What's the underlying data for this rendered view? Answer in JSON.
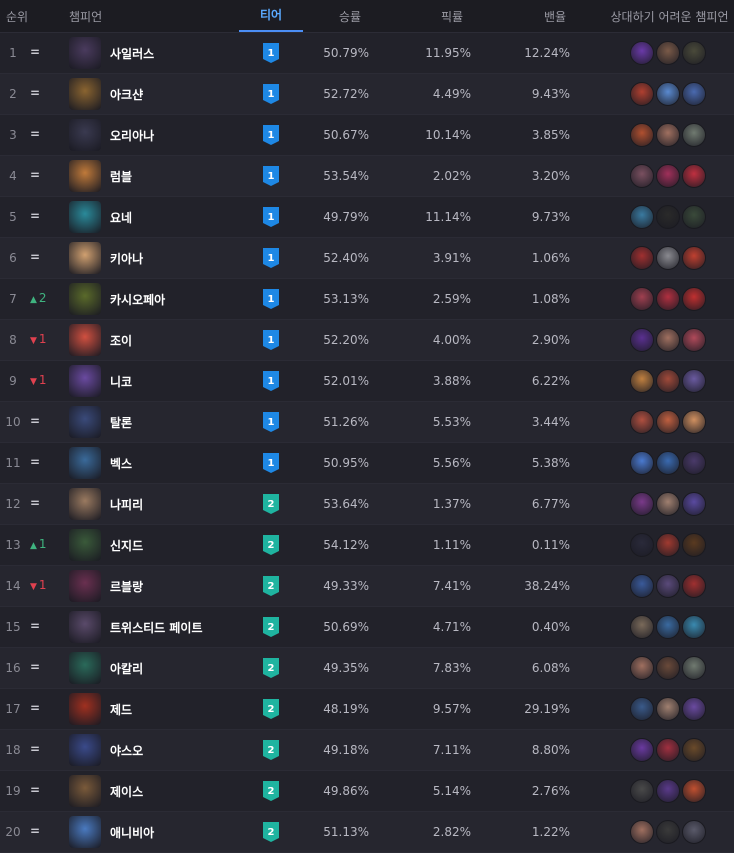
{
  "header": {
    "rank": "순위",
    "champion": "챔피언",
    "tier": "티어",
    "win_rate": "승률",
    "pick_rate": "픽률",
    "ban_rate": "밴율",
    "counters": "상대하기 어려운 챔피언"
  },
  "tier_colors": {
    "1": "#1e88e5",
    "2": "#1fb4a0"
  },
  "rows": [
    {
      "rank": "1",
      "change": "=",
      "trend": "same",
      "name": "사일러스",
      "tier": "1",
      "win": "50.79%",
      "pick": "11.95%",
      "ban": "12.24%",
      "color": "#4a3b5e",
      "counters": [
        "#6a3aa8",
        "#7a5a48",
        "#4a4a3a"
      ]
    },
    {
      "rank": "2",
      "change": "=",
      "trend": "same",
      "name": "아크샨",
      "tier": "1",
      "win": "52.72%",
      "pick": "4.49%",
      "ban": "9.43%",
      "color": "#8a6430",
      "counters": [
        "#b04030",
        "#5a8ad0",
        "#4a6ab0"
      ]
    },
    {
      "rank": "3",
      "change": "=",
      "trend": "same",
      "name": "오리아나",
      "tier": "1",
      "win": "50.67%",
      "pick": "10.14%",
      "ban": "3.85%",
      "color": "#3a3a50",
      "counters": [
        "#b05030",
        "#a07060",
        "#707a70"
      ]
    },
    {
      "rank": "4",
      "change": "=",
      "trend": "same",
      "name": "럼블",
      "tier": "1",
      "win": "53.54%",
      "pick": "2.02%",
      "ban": "3.20%",
      "color": "#c07a3a",
      "counters": [
        "#7a5060",
        "#a0305a",
        "#c03040"
      ]
    },
    {
      "rank": "5",
      "change": "=",
      "trend": "same",
      "name": "요네",
      "tier": "1",
      "win": "49.79%",
      "pick": "11.14%",
      "ban": "9.73%",
      "color": "#2a8a9a",
      "counters": [
        "#3a7aa0",
        "#2a2a2a",
        "#3a4a3a"
      ]
    },
    {
      "rank": "6",
      "change": "=",
      "trend": "same",
      "name": "키아나",
      "tier": "1",
      "win": "52.40%",
      "pick": "3.91%",
      "ban": "1.06%",
      "color": "#d0a070",
      "counters": [
        "#a03030",
        "#8a8a90",
        "#c04030"
      ]
    },
    {
      "rank": "7",
      "change": "2",
      "trend": "up",
      "name": "카시오페아",
      "tier": "1",
      "win": "53.13%",
      "pick": "2.59%",
      "ban": "1.08%",
      "color": "#5a6a2a",
      "counters": [
        "#a04050",
        "#b03040",
        "#c03030"
      ]
    },
    {
      "rank": "8",
      "change": "1",
      "trend": "down",
      "name": "조이",
      "tier": "1",
      "win": "52.20%",
      "pick": "4.00%",
      "ban": "2.90%",
      "color": "#d05040",
      "counters": [
        "#5a3090",
        "#a07060",
        "#b04a5a"
      ]
    },
    {
      "rank": "9",
      "change": "1",
      "trend": "down",
      "name": "니코",
      "tier": "1",
      "win": "52.01%",
      "pick": "3.88%",
      "ban": "6.22%",
      "color": "#6a4aa0",
      "counters": [
        "#c08040",
        "#a04a3a",
        "#6a5aa0"
      ]
    },
    {
      "rank": "10",
      "change": "=",
      "trend": "same",
      "name": "탈론",
      "tier": "1",
      "win": "51.26%",
      "pick": "5.53%",
      "ban": "3.44%",
      "color": "#3a4a7a",
      "counters": [
        "#b05040",
        "#c06040",
        "#d09060"
      ]
    },
    {
      "rank": "11",
      "change": "=",
      "trend": "same",
      "name": "벡스",
      "tier": "1",
      "win": "50.95%",
      "pick": "5.56%",
      "ban": "5.38%",
      "color": "#3a6a9a",
      "counters": [
        "#4a7ad0",
        "#3a6ab0",
        "#4a3a6a"
      ]
    },
    {
      "rank": "12",
      "change": "=",
      "trend": "same",
      "name": "나피리",
      "tier": "2",
      "win": "53.64%",
      "pick": "1.37%",
      "ban": "6.77%",
      "color": "#9a7a60",
      "counters": [
        "#7a3a8a",
        "#a08070",
        "#5a4aa0"
      ]
    },
    {
      "rank": "13",
      "change": "1",
      "trend": "up",
      "name": "신지드",
      "tier": "2",
      "win": "54.12%",
      "pick": "1.11%",
      "ban": "0.11%",
      "color": "#3a5a3a",
      "counters": [
        "#2a2a3a",
        "#a03a30",
        "#5a3a20"
      ]
    },
    {
      "rank": "14",
      "change": "1",
      "trend": "down",
      "name": "르블랑",
      "tier": "2",
      "win": "49.33%",
      "pick": "7.41%",
      "ban": "38.24%",
      "color": "#6a3050",
      "counters": [
        "#3a5a9a",
        "#5a4a7a",
        "#a03030"
      ]
    },
    {
      "rank": "15",
      "change": "=",
      "trend": "same",
      "name": "트위스티드 페이트",
      "tier": "2",
      "win": "50.69%",
      "pick": "4.71%",
      "ban": "0.40%",
      "color": "#5a4a6a",
      "counters": [
        "#7a6a5a",
        "#3a6aa0",
        "#3a8ab0"
      ]
    },
    {
      "rank": "16",
      "change": "=",
      "trend": "same",
      "name": "아칼리",
      "tier": "2",
      "win": "49.35%",
      "pick": "7.83%",
      "ban": "6.08%",
      "color": "#2a6a5a",
      "counters": [
        "#a07060",
        "#6a4a3a",
        "#707a70"
      ]
    },
    {
      "rank": "17",
      "change": "=",
      "trend": "same",
      "name": "제드",
      "tier": "2",
      "win": "48.19%",
      "pick": "9.57%",
      "ban": "29.19%",
      "color": "#a03020",
      "counters": [
        "#3a5a8a",
        "#a08070",
        "#6a4aa0"
      ]
    },
    {
      "rank": "18",
      "change": "=",
      "trend": "same",
      "name": "야스오",
      "tier": "2",
      "win": "49.18%",
      "pick": "7.11%",
      "ban": "8.80%",
      "color": "#3a4a8a",
      "counters": [
        "#6a3aa0",
        "#a03040",
        "#6a4a2a"
      ]
    },
    {
      "rank": "19",
      "change": "=",
      "trend": "same",
      "name": "제이스",
      "tier": "2",
      "win": "49.86%",
      "pick": "5.14%",
      "ban": "2.76%",
      "color": "#7a5a3a",
      "counters": [
        "#4a4a4a",
        "#5a3a8a",
        "#c05030"
      ]
    },
    {
      "rank": "20",
      "change": "=",
      "trend": "same",
      "name": "애니비아",
      "tier": "2",
      "win": "51.13%",
      "pick": "2.82%",
      "ban": "1.22%",
      "color": "#4a7ac0",
      "counters": [
        "#a07060",
        "#3a3a3a",
        "#5a5a6a"
      ]
    }
  ]
}
